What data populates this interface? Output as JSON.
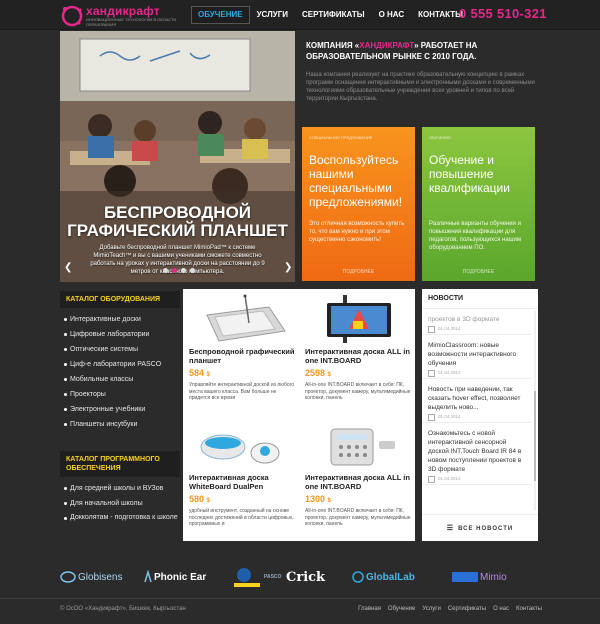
{
  "header": {
    "logo_name": "хандикрафт",
    "logo_tagline": "Инновационные технологии в области образования",
    "nav": [
      {
        "label": "ОБУЧЕНИЕ",
        "active": true
      },
      {
        "label": "УСЛУГИ",
        "active": false
      },
      {
        "label": "СЕРТИФИКАТЫ",
        "active": false
      },
      {
        "label": "О НАС",
        "active": false
      },
      {
        "label": "КОНТАКТЫ",
        "active": false
      }
    ],
    "phone": "0 555 510-321",
    "accent_color": "#e6288c"
  },
  "hero": {
    "title": "БЕСПРОВОДНОЙ ГРАФИЧЕСКИЙ ПЛАНШЕТ",
    "text": "Добавьте беспроводной планшет MimioPad™ к системе MimioTeach™ и вы с вашими учениками сможете совместно работать на уроках у интерактивной доски на расстоянии до 9 метров от классного компьютера.",
    "prev_icon": "chevron-left-icon",
    "next_icon": "chevron-right-icon"
  },
  "intro": {
    "title_prefix": "КОМПАНИЯ «",
    "title_brand": "ХАНДИКРАФТ",
    "title_suffix": "» РАБОТАЕТ НА ОБРАЗОВАТЕЛЬНОМ РЫНКЕ С 2010 ГОДА.",
    "text": "Наша компания реализует на практике образовательную концепцию в рамках программ оснащения интерактивными и электронными досками и современными технологиями образовательные учреждения всех уровней и типов по всей территории Кыргызстана."
  },
  "tiles": [
    {
      "kicker": "СПЕЦИАЛЬНОЕ ПРЕДЛОЖЕНИЕ",
      "title": "Воспользуйтесь нашими специальными предложениями!",
      "text": "Это отличная возможность купить то, что вам нужно и при этом существенно сэкономить!",
      "more": "ПОДРОБНЕЕ",
      "color": "#f8941d"
    },
    {
      "kicker": "ОБУЧЕНИЕ",
      "title": "Обучение и повышение квалификации",
      "text": "Различные варианты обучения и повышения квалификации для педагогов, пользующихся нашим оборудованием ПО.",
      "more": "ПОДРОБНЕЕ",
      "color": "#8dc63f"
    }
  ],
  "sidebar": {
    "equipment_title": "КАТАЛОГ ОБОРУДОВАНИЯ",
    "equipment_items": [
      "Интерактивные доски",
      "Цифровые лаборатории",
      "Оптические системы",
      "Циф-е лаборатории PASCO",
      "Мобильные классы",
      "Проекторы",
      "Электронные учебники",
      "Планшеты инсуtбуки"
    ],
    "software_title": "КАТАЛОГ ПРОГРАММНОГО ОБЕСПЕЧЕНИЯ",
    "software_items": [
      "Для средней школы и ВУЗов",
      "Для начальной школы",
      "Докколятам - подготовка к школе"
    ]
  },
  "products": [
    {
      "title": "Беспроводной графический планшет",
      "price": "584",
      "currency": "$",
      "desc": "Управляйте интерактивной доской из любого места вашего класса. Вам больше не придется все время"
    },
    {
      "title": "Интерактивная доска ALL in one INT.BOARD",
      "price": "2598",
      "currency": "$",
      "desc": "All-in-one INT.BOARD включает в себя: ПК, проектор, документ камеру, мультимедийные колонки, панель"
    },
    {
      "title": "Интерактивная доска WhiteBoard DualPen",
      "price": "580",
      "currency": "$",
      "desc": "удобный инструмент, созданный на основе последних достижений в области цифровых, программных и"
    },
    {
      "title": "Интерактивная доска ALL in one INT.BOARD",
      "price": "1300",
      "currency": "$",
      "desc": "All-in-one INT.BOARD включает в себя: ПК, проектор, документ камеру, мультимедийные колонки, панель"
    }
  ],
  "news": {
    "title": "НОВОСТИ",
    "items": [
      {
        "text": "проектов в 3D формате",
        "date": "01.04.2014",
        "faded": true
      },
      {
        "text": "MimioClassroom: новые возможности интерактивного обучения",
        "date": "01.04.2014",
        "faded": false
      },
      {
        "text": "Новость при наведении, так сказать hover effect, позволяет выделить ново...",
        "date": "01.04.2014",
        "faded": false
      },
      {
        "text": "Ознакомьтесь с новой интерактивной сенсорной доской INT.Touch Board IR 84 в новом поступлении проектов в 3D формате",
        "date": "01.04.2014",
        "faded": false
      }
    ],
    "all_label": "ВСЕ НОВОСТИ"
  },
  "partners": [
    {
      "name": "Globisens"
    },
    {
      "name": "Phonic Ear"
    },
    {
      "name": "PASCO"
    },
    {
      "name": "Crick"
    },
    {
      "name": "GlobalLab"
    },
    {
      "name": "Mimio"
    }
  ],
  "footer": {
    "copyright": "© ОсОО «Хандикрафт», Бишкек, Кыргызстан",
    "links": [
      "Главная",
      "Обучение",
      "Услуги",
      "Сертификаты",
      "О нас",
      "Контакты"
    ]
  }
}
